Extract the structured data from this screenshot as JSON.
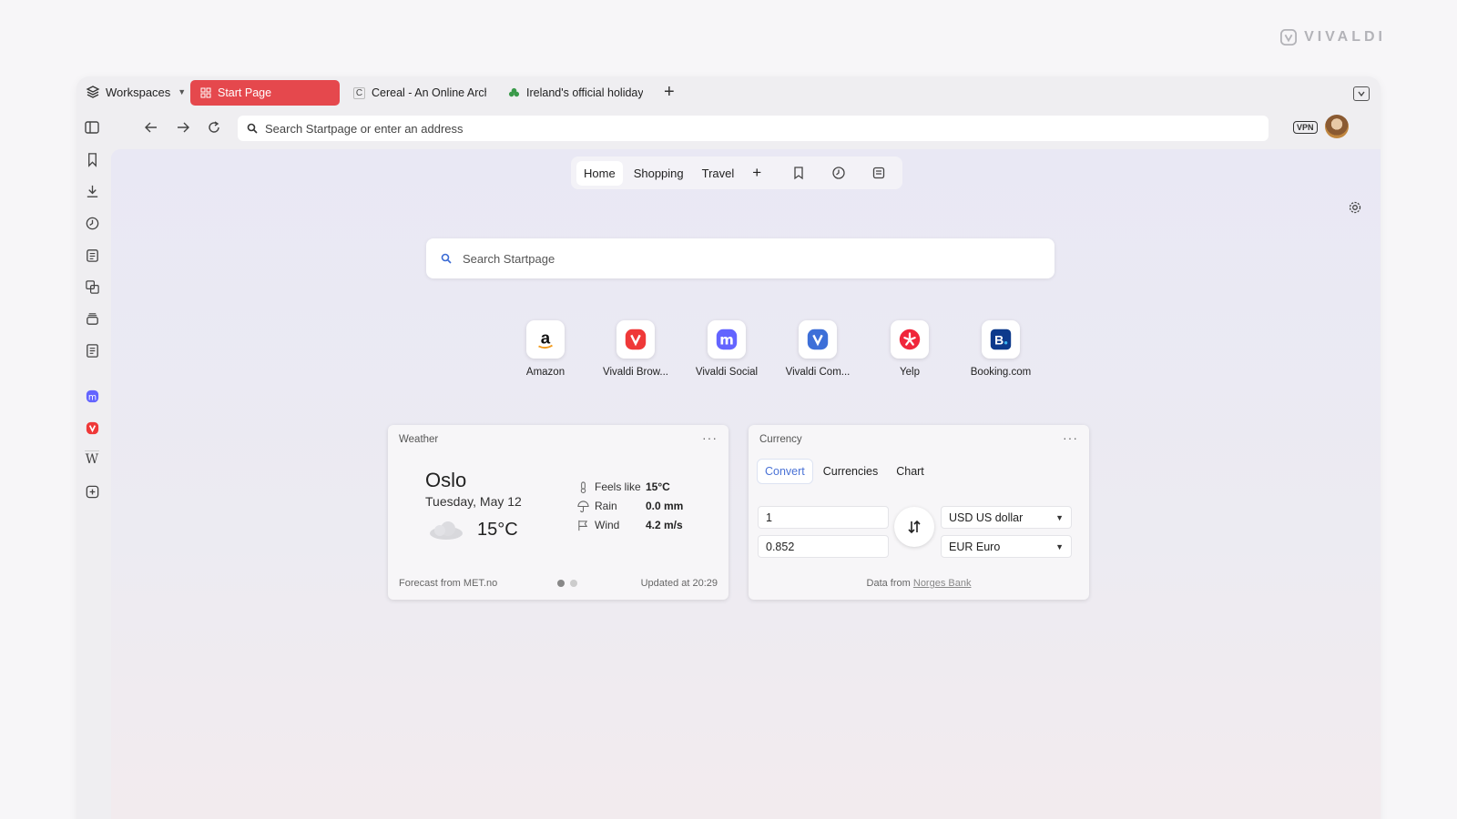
{
  "brand": {
    "name": "VIVALDI"
  },
  "tabbar": {
    "workspaces_label": "Workspaces",
    "tabs": [
      {
        "label": "Start Page",
        "favicon": "grid-icon",
        "active": true
      },
      {
        "label": "Cereal - An Online Archive",
        "favicon": "cereal-favicon",
        "favicon_text": "C",
        "active": false
      },
      {
        "label": "Ireland's official holiday an",
        "favicon": "shamrock-icon",
        "active": false
      }
    ],
    "new_tab": "+"
  },
  "address_bar": {
    "placeholder": "Search Startpage or enter an address"
  },
  "toolbar": {
    "vpn_label": "VPN"
  },
  "startpage": {
    "nav": {
      "tabs": [
        "Home",
        "Shopping",
        "Travel"
      ],
      "active": "Home",
      "add": "+"
    },
    "search_placeholder": "Search Startpage",
    "speed_dials": [
      {
        "name": "Amazon",
        "icon": "amazon-icon"
      },
      {
        "name": "Vivaldi Brow...",
        "icon": "vivaldi-icon"
      },
      {
        "name": "Vivaldi Social",
        "icon": "mastodon-icon"
      },
      {
        "name": "Vivaldi Com...",
        "icon": "vivaldi-community-icon"
      },
      {
        "name": "Yelp",
        "icon": "yelp-icon"
      },
      {
        "name": "Booking.com",
        "icon": "booking-icon"
      }
    ]
  },
  "weather": {
    "title": "Weather",
    "more": "···",
    "city": "Oslo",
    "date": "Tuesday, May 12",
    "temperature": "15°C",
    "details": [
      {
        "label": "Feels like",
        "value": "15°C",
        "icon": "thermometer-icon"
      },
      {
        "label": "Rain",
        "value": "0.0 mm",
        "icon": "umbrella-icon"
      },
      {
        "label": "Wind",
        "value": "4.2 m/s",
        "icon": "flag-icon"
      }
    ],
    "source": "Forecast from MET.no",
    "updated": "Updated at 20:29",
    "pages": 2,
    "current_page": 1
  },
  "currency": {
    "title": "Currency",
    "more": "···",
    "tabs": [
      "Convert",
      "Currencies",
      "Chart"
    ],
    "active_tab": "Convert",
    "amount_from": "1",
    "amount_to": "0.852",
    "currency_from": "USD US dollar",
    "currency_to": "EUR Euro",
    "footer_prefix": "Data from",
    "footer_link": "Norges Bank"
  },
  "colors": {
    "accent_tab": "#e5484d",
    "link_blue": "#4a72d6"
  }
}
